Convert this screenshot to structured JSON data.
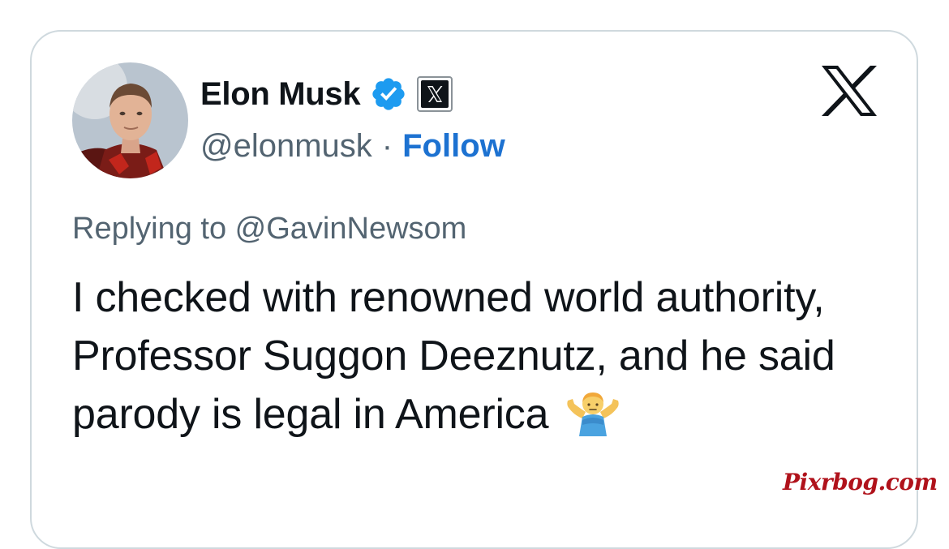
{
  "tweet": {
    "author": {
      "display_name": "Elon Musk",
      "handle": "@elonmusk",
      "separator": "·",
      "follow_label": "Follow",
      "verified": true,
      "avatar": "profile-photo"
    },
    "replying_to": "Replying to @GavinNewsom",
    "text": "I checked with renowned world authority, Professor Suggon Deeznutz, and he said parody is legal in America",
    "emoji": "person-shrugging-icon"
  },
  "platform_logo": "x-logo-icon",
  "watermark": "Pixrbog.com",
  "colors": {
    "name_text": "#0f1419",
    "secondary_text": "#536471",
    "follow_link": "#1d72d1",
    "verified_badge": "#1d9bf0",
    "card_border": "#cfd9de",
    "watermark": "#b0121b"
  }
}
